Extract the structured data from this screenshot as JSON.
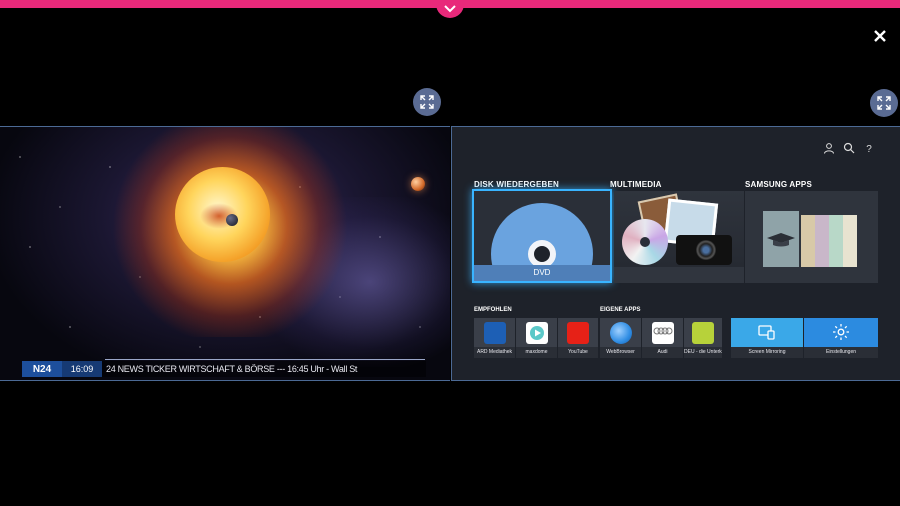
{
  "tv": {
    "channel": "N24",
    "time": "16:09",
    "ticker": "24 NEWS TICKER WIRTSCHAFT & BÖRSE --- 16:45 Uhr - Wall St"
  },
  "hub": {
    "sections": {
      "disk": "DISK WIEDERGEBEN",
      "multimedia": "MULTIMEDIA",
      "samsung_apps": "SAMSUNG APPS",
      "empfohlen": "EMPFOHLEN",
      "eigene_apps": "EIGENE APPS"
    },
    "dvd_label": "DVD",
    "empfohlen_apps": [
      {
        "label": "ARD Mediathek",
        "icon": "ard-icon",
        "color": "#1d5fb5"
      },
      {
        "label": "maxdome",
        "icon": "maxdome-icon",
        "color": "#ffffff"
      },
      {
        "label": "YouTube",
        "icon": "youtube-icon",
        "color": "#e62117"
      }
    ],
    "eigene_apps": [
      {
        "label": "WebBrowser",
        "icon": "globe-icon",
        "color": "#2f8de4"
      },
      {
        "label": "Audi",
        "icon": "audi-icon",
        "color": "#ffffff"
      },
      {
        "label": "DEU - die Unterkunft am ARD und ZDF",
        "icon": "deu-icon",
        "color": "#b7d23a"
      }
    ],
    "feature_apps": [
      {
        "label": "Screen Mirroring",
        "icon": "screen-mirroring-icon",
        "color": "#3aa8e8"
      },
      {
        "label": "Einstellungen",
        "icon": "gear-icon",
        "color": "#2c8be0"
      }
    ]
  }
}
